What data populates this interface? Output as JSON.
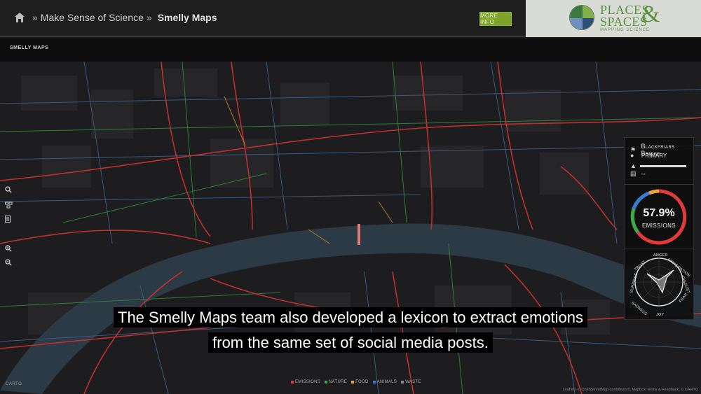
{
  "header": {
    "breadcrumb_sep": "»",
    "breadcrumb_parent": "Make Sense of Science",
    "breadcrumb_current": "Smelly Maps",
    "more_info_label": "MORE INFO",
    "logo": {
      "line1": "PLACES",
      "line2": "SPACES",
      "amp": "&",
      "tagline": "MAPPING SCIENCE"
    }
  },
  "app": {
    "logo_text": "SMELLY MAPS"
  },
  "map": {
    "controls": [
      "search-icon",
      "layers-icon",
      "list-icon",
      "zoom-in-icon",
      "zoom-out-icon"
    ]
  },
  "info_panel": {
    "street_name": "Blackfriars Bridge",
    "road_type": "PRIMARY",
    "emissions_percent": "57.9%",
    "emissions_label": "EMISSIONS",
    "emotions": [
      "ANGER",
      "ANTICIPATION",
      "DISGUST",
      "FEAR",
      "JOY",
      "SADNESS",
      "SURPRISE",
      "TRUST"
    ],
    "colors": {
      "emissions": "#e23a3a",
      "nature": "#3ea84a",
      "food": "#e8a53a",
      "animals": "#3a7ad6",
      "waste": "#6a6a6a"
    }
  },
  "caption": {
    "line1": "The Smelly Maps team also developed a lexicon to extract emotions",
    "line2": "from the same set of social media posts."
  },
  "legend": {
    "items": [
      {
        "label": "EMISSIONS",
        "color": "#e23a3a"
      },
      {
        "label": "NATURE",
        "color": "#3ea84a"
      },
      {
        "label": "FOOD",
        "color": "#e8a53a"
      },
      {
        "label": "ANIMALS",
        "color": "#3a7ad6"
      },
      {
        "label": "WASTE",
        "color": "#8a8a8a"
      }
    ]
  },
  "attribution": {
    "carto": "CARTO",
    "text": "Leaflet | © OpenStreetMap contributors, Mapbox Terms & Feedback, © CARTO"
  }
}
